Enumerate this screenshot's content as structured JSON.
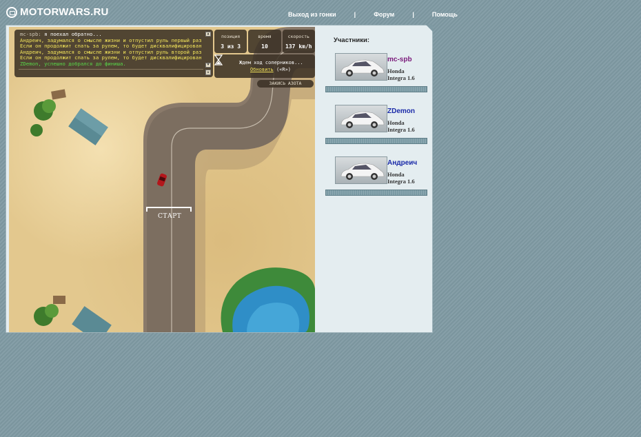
{
  "header": {
    "logo_text": "MOTORWARS.RU",
    "nav": [
      {
        "label": "Выход из гонки"
      },
      {
        "label": "Форум"
      },
      {
        "label": "Помощь"
      }
    ],
    "separator": "|"
  },
  "chat": {
    "messages": [
      {
        "author": "mc-spb:",
        "text": " я поехал обратно...",
        "color": "#ffffff",
        "author_color": "#cfc7b8"
      },
      {
        "text": "Андреич, задумался о смысле жизни и отпустил руль первый раз.",
        "color": "#f3e45a"
      },
      {
        "text": "Если он продолжит спать за рулем, то будет дисквалифицирован.",
        "color": "#f3e45a"
      },
      {
        "text": "Андреич, задумался о смысле жизни и отпустил руль второй раз.",
        "color": "#f3e45a"
      },
      {
        "text": "Если он продолжит спать за рулем, то будет дисквалифицирован.",
        "color": "#f3e45a"
      },
      {
        "text": "ZDemon, успешно добрался до финиша.",
        "color": "#58d84a"
      }
    ]
  },
  "stats": {
    "position_label": "позиция",
    "position_value": "3 из 3",
    "time_label": "время",
    "time_value": "10",
    "speed_label": "скорость",
    "speed_value": "137 km/h"
  },
  "waiting": {
    "text": "Ждем ход соперников...",
    "refresh_link": "Обновить",
    "refresh_hint": "(«R»)"
  },
  "nitro_button": "ЗАКИСЬ АЗОТА",
  "start_label": "СТАРТ",
  "participants": {
    "title": "Участники:",
    "list": [
      {
        "name": "mc-spb",
        "name_color": "#7a1a7a",
        "car_make": "Honda",
        "car_model": "Integra 1.6"
      },
      {
        "name": "ZDemon",
        "name_color": "#1a2aa8",
        "car_make": "Honda",
        "car_model": "Integra 1.6"
      },
      {
        "name": "Андреич",
        "name_color": "#1a2aa8",
        "car_make": "Honda",
        "car_model": "Integra 1.6"
      }
    ]
  }
}
